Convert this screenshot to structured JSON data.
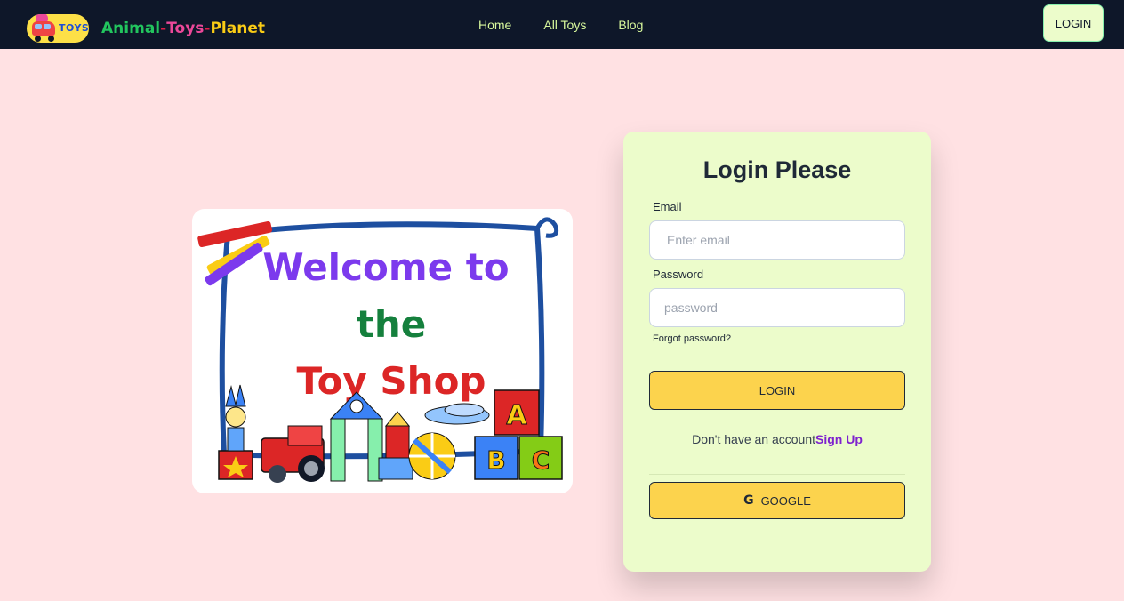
{
  "nav": {
    "logo_tag": "TOYS",
    "brand_part1": "Animal",
    "brand_sep1": "-",
    "brand_part2": "Toys",
    "brand_sep2": "-",
    "brand_part3": "Planet",
    "links": [
      {
        "label": "Home"
      },
      {
        "label": "All Toys"
      },
      {
        "label": "Blog"
      }
    ],
    "login_label": "LOGIN"
  },
  "welcome_image": {
    "line1": "Welcome to",
    "line2": "the",
    "line3": "Toy Shop",
    "block_letters": [
      "A",
      "B",
      "C"
    ]
  },
  "login_card": {
    "title": "Login Please",
    "email_label": "Email",
    "email_placeholder": "Enter email",
    "password_label": "Password",
    "password_placeholder": "password",
    "forgot_label": "Forgot password?",
    "login_button": "LOGIN",
    "signup_prompt": "Don't have an account",
    "signup_link": "Sign Up",
    "google_icon_glyph": "G",
    "google_button": "GOOGLE"
  },
  "colors": {
    "navbar_bg": "#0e1729",
    "page_bg": "#ffe1e3",
    "card_bg": "#ecfccb",
    "button_bg": "#fcd34d",
    "link_purple": "#7e22ce",
    "nav_link": "#d9f99d"
  }
}
